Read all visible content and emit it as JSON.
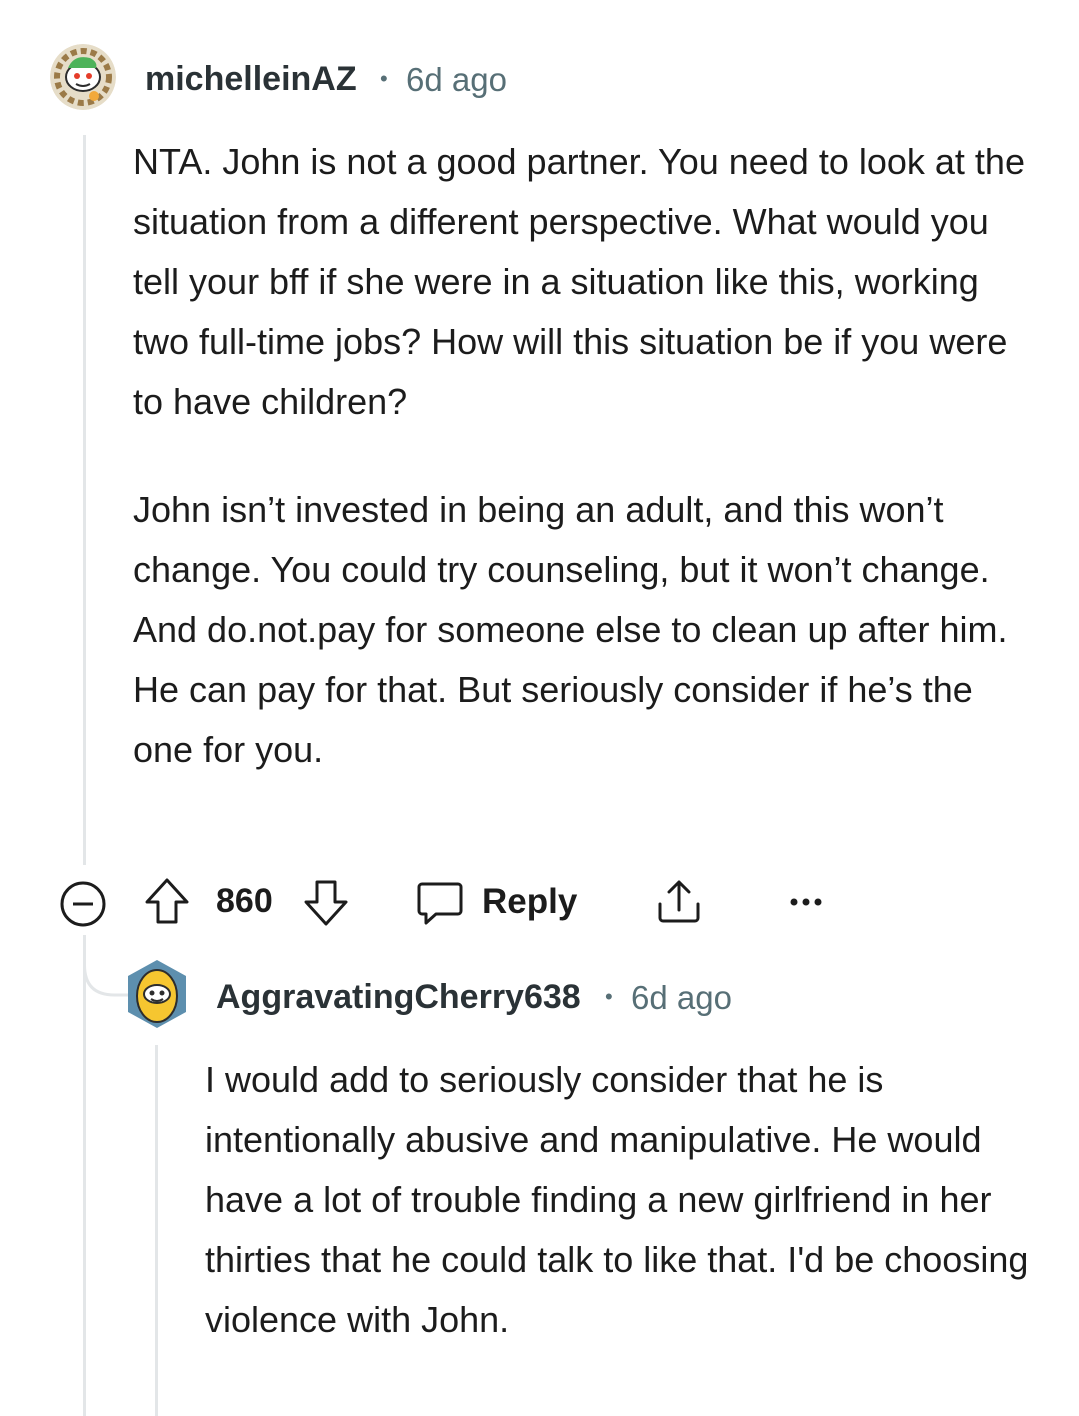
{
  "comment": {
    "username": "michelleinAZ",
    "separator": "•",
    "time": "6d ago",
    "paragraphs": [
      "NTA. John is not a good partner. You need to look at the situation from a different perspective. What would you tell your bff if she were in a situation like this, working two full-time jobs? How will this situation be if you were to have children?",
      "John isn’t invested in being an adult, and this won’t change. You could try counseling, but it won’t change. And do.not.pay for someone else to clean up after him. He can pay for that. But seriously consider if he’s the one for you."
    ],
    "vote_count": "860",
    "reply_label": "Reply"
  },
  "reply": {
    "username": "AggravatingCherry638",
    "separator": "•",
    "time": "6d ago",
    "paragraphs": [
      "I would add to seriously consider that he is intentionally abusive and manipulative. He would have a lot of trouble finding a new girlfriend in her thirties that he could talk to like that. I'd be choosing violence with John."
    ]
  },
  "icons": [
    "collapse-icon",
    "upvote-icon",
    "downvote-icon",
    "comment-bubble-icon",
    "share-icon",
    "more-options-icon"
  ],
  "colors": {
    "text": "#1c1c1c",
    "meta": "#576f76",
    "thread_line": "#e3e6e8"
  }
}
